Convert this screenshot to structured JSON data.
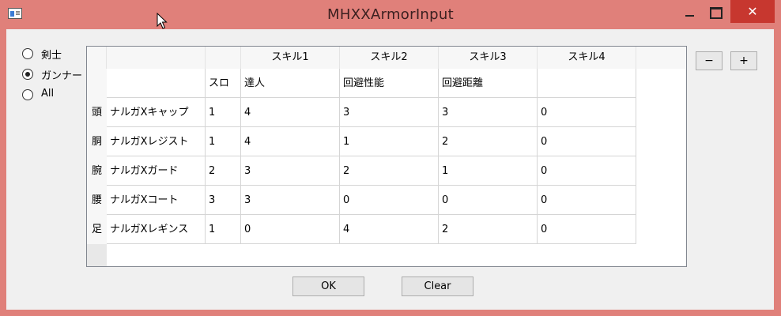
{
  "window": {
    "title": "MHXXArmorInput",
    "close_glyph": "✕",
    "icon": "window-app-icon"
  },
  "radios": [
    {
      "label": "剣士",
      "checked": false
    },
    {
      "label": "ガンナー",
      "checked": true
    },
    {
      "label": "All",
      "checked": false
    }
  ],
  "grid": {
    "header": [
      "スキル1",
      "スキル2",
      "スキル3",
      "スキル4"
    ],
    "subheader": [
      "スロ",
      "達人",
      "回避性能",
      "回避距離",
      ""
    ],
    "rows": [
      {
        "part": "頭",
        "name": "ナルガXキャップ",
        "slot": "1",
        "s1": "4",
        "s2": "3",
        "s3": "3",
        "s4": "0"
      },
      {
        "part": "胴",
        "name": "ナルガXレジスト",
        "slot": "1",
        "s1": "4",
        "s2": "1",
        "s3": "2",
        "s4": "0"
      },
      {
        "part": "腕",
        "name": "ナルガXガード",
        "slot": "2",
        "s1": "3",
        "s2": "2",
        "s3": "1",
        "s4": "0"
      },
      {
        "part": "腰",
        "name": "ナルガXコート",
        "slot": "3",
        "s1": "3",
        "s2": "0",
        "s3": "0",
        "s4": "0"
      },
      {
        "part": "足",
        "name": "ナルガXレギンス",
        "slot": "1",
        "s1": "0",
        "s2": "4",
        "s3": "2",
        "s4": "0"
      }
    ]
  },
  "buttons": {
    "minus": "−",
    "plus": "+",
    "ok": "OK",
    "clear": "Clear"
  },
  "colors": {
    "titlebar": "#E0807A",
    "close": "#C7372F",
    "client": "#F0F0F0"
  }
}
